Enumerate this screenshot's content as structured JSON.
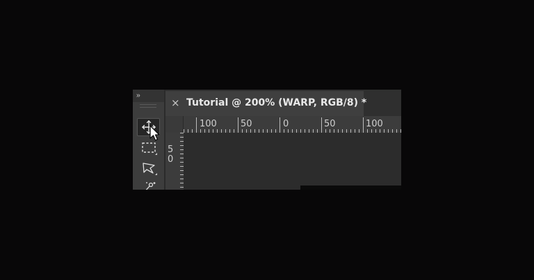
{
  "toolbar": {
    "collapse_glyph": "››",
    "tools": [
      {
        "name": "move-tool",
        "icon": "move-icon",
        "active": true
      },
      {
        "name": "marquee-tool",
        "icon": "rectangular-marquee-icon",
        "active": false
      },
      {
        "name": "lasso-tool",
        "icon": "polygonal-lasso-icon",
        "active": false
      },
      {
        "name": "quick-selection-tool",
        "icon": "quick-selection-icon",
        "active": false
      }
    ]
  },
  "document_tab": {
    "close_glyph": "×",
    "title": "Tutorial @ 200% (WARP, RGB/8) *"
  },
  "ruler_h": {
    "labels": [
      "100",
      "50",
      "0",
      "50",
      "100"
    ]
  },
  "ruler_v": {
    "label": "50"
  },
  "colors": {
    "background": "#080708",
    "toolbar": "#3d3d3d",
    "tab": "#3f3f3f",
    "ruler": "#3c3c3c",
    "canvas": "#2c2c2c"
  }
}
